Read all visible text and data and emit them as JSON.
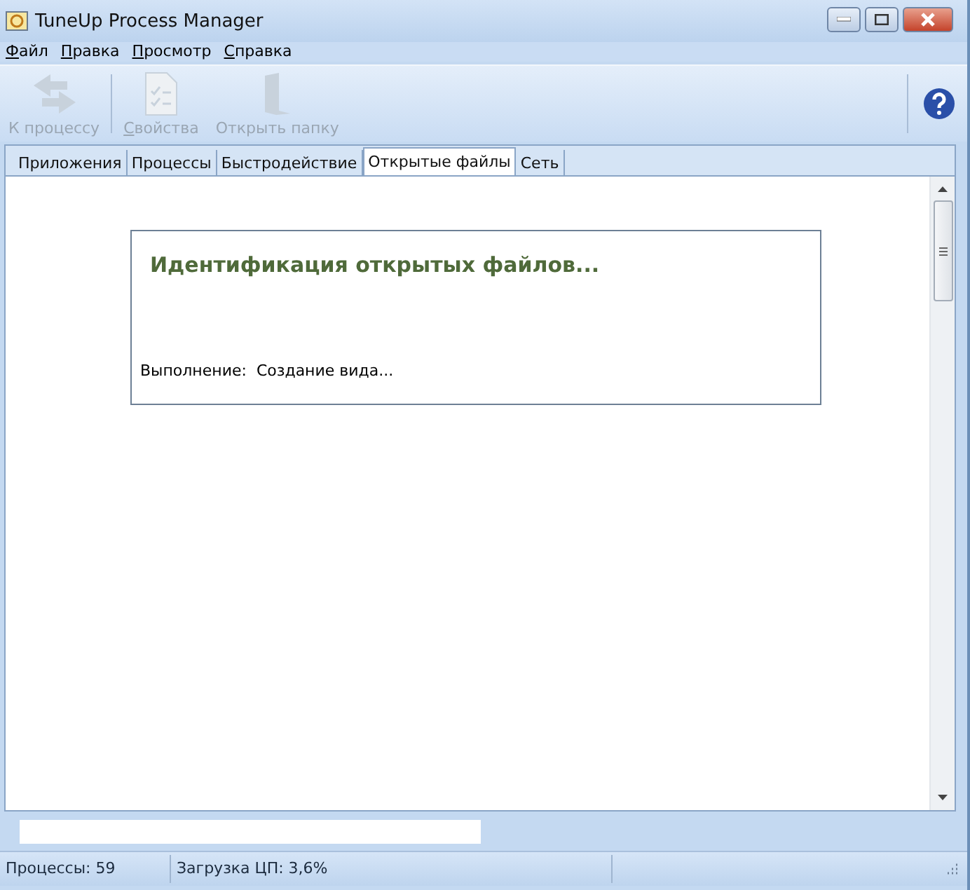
{
  "window": {
    "title": "TuneUp Process Manager"
  },
  "menu": [
    {
      "label": "Файл",
      "underline_first": true
    },
    {
      "label": "Правка",
      "underline_first": true
    },
    {
      "label": "Просмотр",
      "underline_first": true
    },
    {
      "label": "Справка",
      "underline_first": true
    }
  ],
  "toolbar": [
    {
      "kind": "arrows",
      "label": "К процессу",
      "disabled": true,
      "underline_first": false
    },
    {
      "kind": "document",
      "label": "Свойства",
      "disabled": true,
      "underline_first": true
    },
    {
      "kind": "folder",
      "label": "Открыть папку",
      "disabled": true,
      "underline_first": false
    }
  ],
  "tabs": [
    {
      "label": "Приложения",
      "selected": false
    },
    {
      "label": "Процессы",
      "selected": false
    },
    {
      "label": "Быстродействие",
      "selected": false
    },
    {
      "label": "Открытые файлы",
      "selected": true
    },
    {
      "label": "Сеть",
      "selected": false
    }
  ],
  "progress_panel": {
    "title": "Идентификация открытых файлов...",
    "status_label": "Выполнение:",
    "status_value": "Создание вида..."
  },
  "status_bar": [
    "Процессы: 59",
    "Загрузка ЦП: 3,6%"
  ]
}
